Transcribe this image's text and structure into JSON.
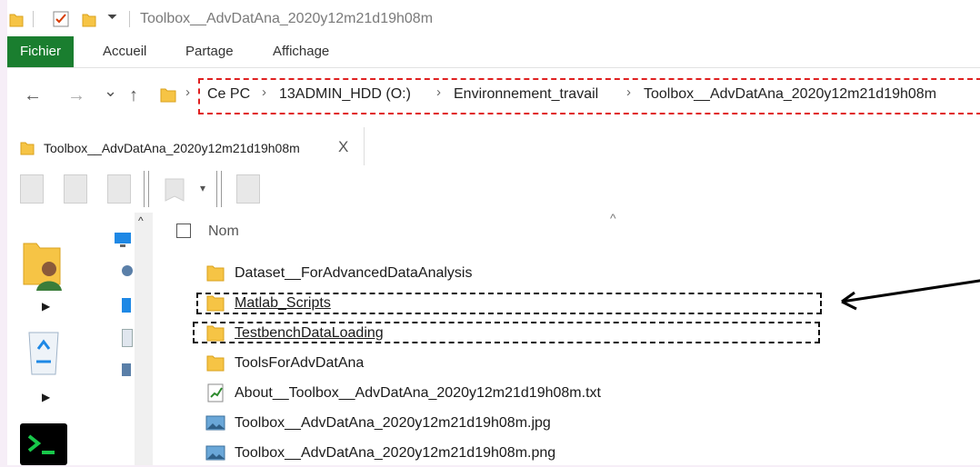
{
  "window_title": "Toolbox__AdvDatAna_2020y12m21d19h08m",
  "quick_access": [
    "folder-icon",
    "checkmark-icon",
    "folder-icon",
    "dropdown-icon"
  ],
  "ribbon": {
    "tabs": [
      {
        "label": "Fichier",
        "active": true
      },
      {
        "label": "Accueil"
      },
      {
        "label": "Partage"
      },
      {
        "label": "Affichage"
      }
    ],
    "accent": "#1a7e2f"
  },
  "nav": {
    "back": "←",
    "forward": "→",
    "recent": "⌄",
    "up": "↑"
  },
  "breadcrumbs": [
    "Ce PC",
    "13ADMIN_HDD (O:)",
    "Environnement_travail",
    "Toolbox__AdvDatAna_2020y12m21d19h08m"
  ],
  "tab": {
    "label": "Toolbox__AdvDatAna_2020y12m21d19h08m",
    "close": "X"
  },
  "list": {
    "header": "Nom",
    "items": [
      {
        "name": "Dataset__ForAdvancedDataAnalysis",
        "type": "folder"
      },
      {
        "name": "Matlab_Scripts",
        "type": "folder",
        "highlight": true
      },
      {
        "name": "TestbenchDataLoading",
        "type": "folder",
        "highlight": true
      },
      {
        "name": "ToolsForAdvDatAna",
        "type": "folder"
      },
      {
        "name": "About__Toolbox__AdvDatAna_2020y12m21d19h08m.txt",
        "type": "text"
      },
      {
        "name": "Toolbox__AdvDatAna_2020y12m21d19h08m.jpg",
        "type": "image"
      },
      {
        "name": "Toolbox__AdvDatAna_2020y12m21d19h08m.png",
        "type": "image"
      }
    ]
  },
  "highlight_color": "#e02020"
}
